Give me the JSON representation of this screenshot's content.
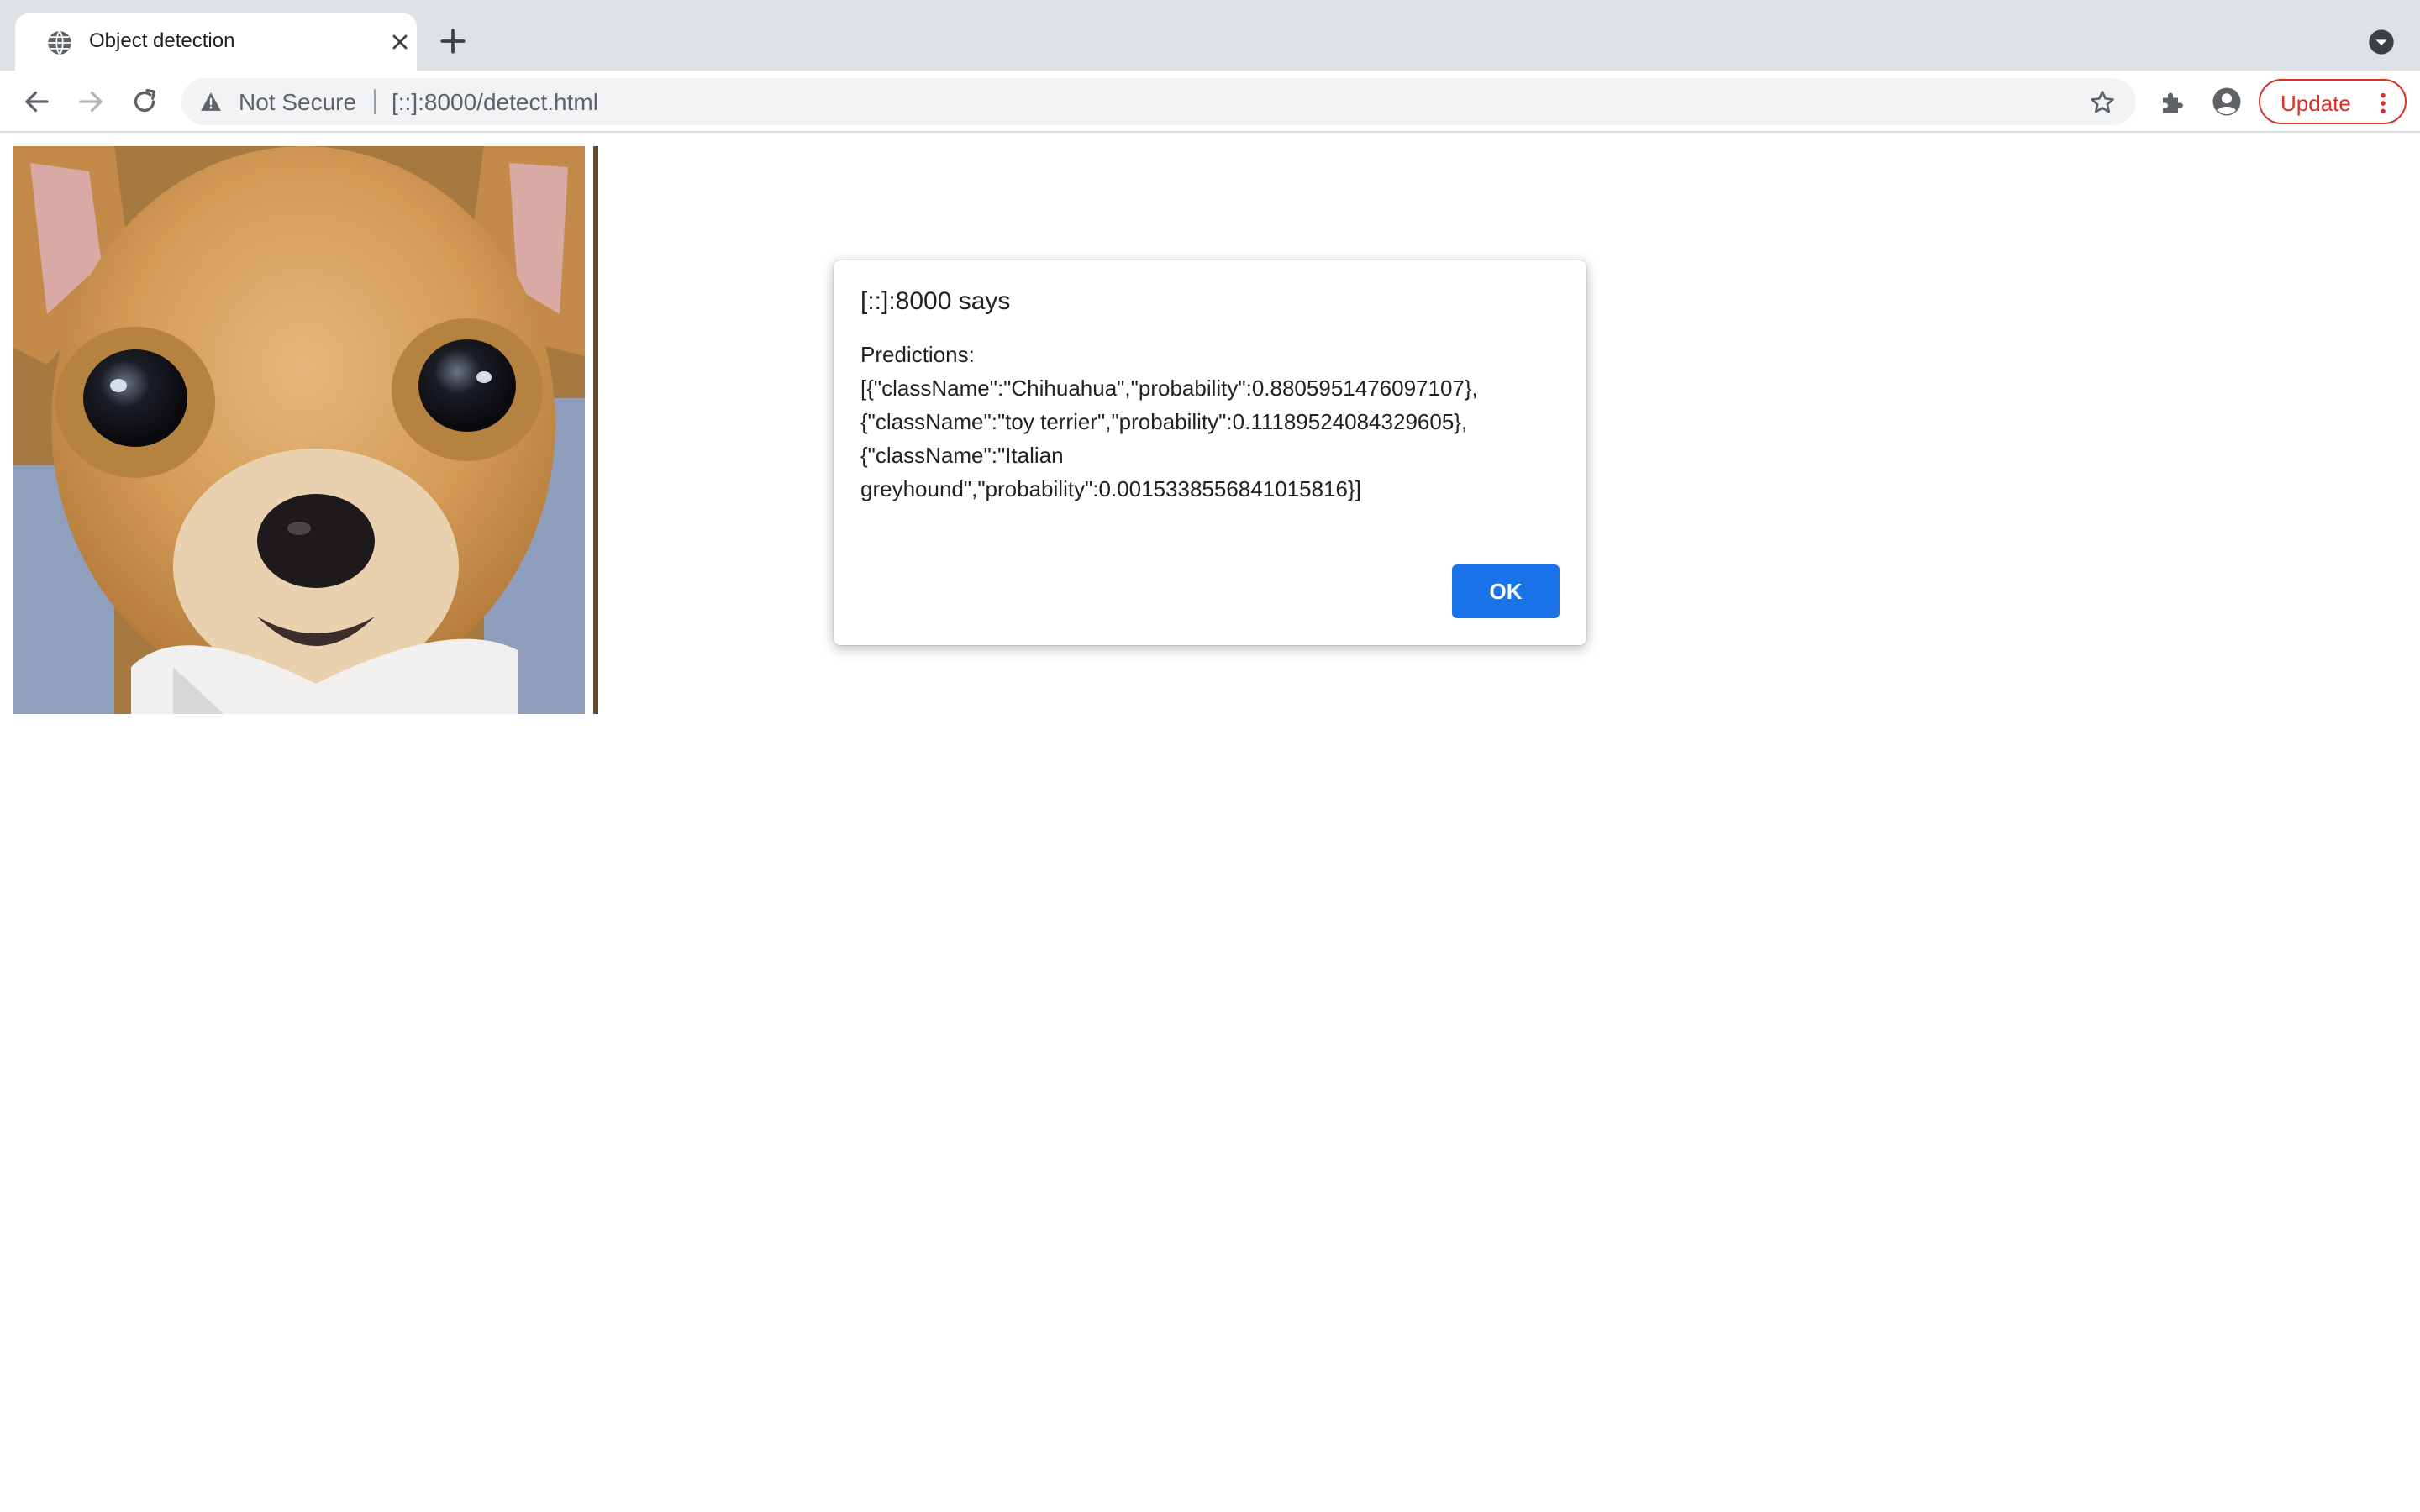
{
  "browser": {
    "tab": {
      "title": "Object detection",
      "favicon": "globe-icon",
      "close_icon": "close-icon"
    },
    "new_tab_icon": "plus-icon",
    "tab_search_icon": "chevron-down-circle-icon",
    "toolbar": {
      "back_icon": "arrow-left-icon",
      "forward_icon": "arrow-right-icon",
      "reload_icon": "reload-icon",
      "security_icon": "warning-icon",
      "security_label": "Not Secure",
      "url": "[::]:8000/detect.html",
      "bookmark_icon": "star-icon",
      "extensions_icon": "puzzle-icon",
      "profile_icon": "person-circle-icon",
      "update_label": "Update",
      "menu_icon": "kebab-menu-icon"
    }
  },
  "colors": {
    "tabstrip": "#dee1e6",
    "omnibox": "#f1f3f4",
    "update_red": "#d93025",
    "ok_blue": "#1a73e8"
  },
  "page": {
    "image": {
      "subject": "chihuahua-photo"
    }
  },
  "alert": {
    "title": "[::]:8000 says",
    "message": "Predictions:\n[{\"className\":\"Chihuahua\",\"probability\":0.8805951476097107},\n{\"className\":\"toy terrier\",\"probability\":0.11189524084329605},\n{\"className\":\"Italian\ngreyhound\",\"probability\":0.0015338556841015816}]",
    "ok_label": "OK"
  }
}
